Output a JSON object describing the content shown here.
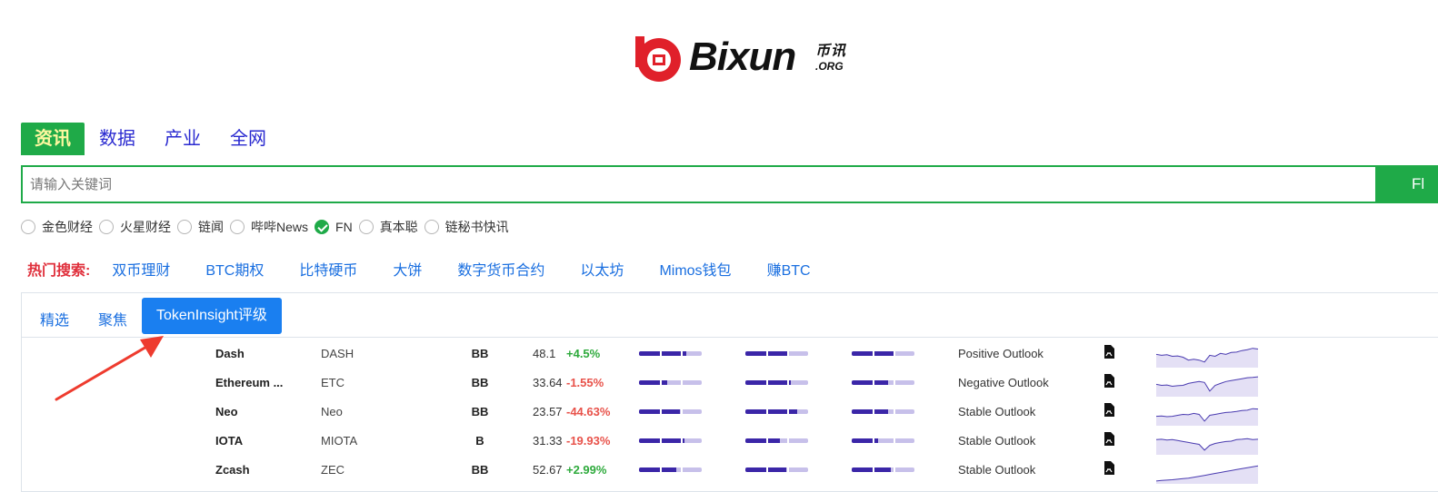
{
  "logo": {
    "name": "Bixun",
    "cn": "币讯",
    "org": ".ORG",
    "colors": {
      "red": "#e0202a",
      "black": "#111111"
    }
  },
  "category_tabs": [
    {
      "label": "资讯",
      "active": true
    },
    {
      "label": "数据",
      "active": false
    },
    {
      "label": "产业",
      "active": false
    },
    {
      "label": "全网",
      "active": false
    }
  ],
  "search": {
    "placeholder": "请输入关键词",
    "value": "",
    "button_label": "Fl"
  },
  "sources": [
    {
      "label": "金色财经",
      "checked": false
    },
    {
      "label": "火星财经",
      "checked": false
    },
    {
      "label": "链闻",
      "checked": false
    },
    {
      "label": "哔哔News",
      "checked": false
    },
    {
      "label": "FN",
      "checked": true
    },
    {
      "label": "真本聪",
      "checked": false
    },
    {
      "label": "链秘书快讯",
      "checked": false
    }
  ],
  "hot_search": {
    "label": "热门搜索:",
    "links": [
      "双币理财",
      "BTC期权",
      "比特硬币",
      "大饼",
      "数字货币合约",
      "以太坊",
      "Mimos钱包",
      "赚BTC"
    ]
  },
  "panel_tabs": [
    {
      "label": "精选",
      "active": false
    },
    {
      "label": "聚焦",
      "active": false
    },
    {
      "label": "TokenInsight评级",
      "active": true
    }
  ],
  "ratings": [
    {
      "name": "Dash",
      "symbol": "DASH",
      "grade": "BB",
      "score": "48.1",
      "change": "+4.5%",
      "direction": "up",
      "bars": [
        0.75,
        0.7,
        0.68
      ],
      "outlook": "Positive Outlook",
      "spark": [
        0.6,
        0.55,
        0.58,
        0.5,
        0.52,
        0.45,
        0.3,
        0.35,
        0.3,
        0.2,
        0.55,
        0.5,
        0.65,
        0.6,
        0.7,
        0.72,
        0.8,
        0.85,
        0.92,
        0.88
      ]
    },
    {
      "name": "Ethereum ...",
      "symbol": "ETC",
      "grade": "BB",
      "score": "33.64",
      "change": "-1.55%",
      "direction": "down",
      "bars": [
        0.45,
        0.72,
        0.58
      ],
      "outlook": "Negative Outlook",
      "spark": [
        0.55,
        0.5,
        0.52,
        0.45,
        0.48,
        0.5,
        0.6,
        0.65,
        0.7,
        0.65,
        0.2,
        0.5,
        0.6,
        0.7,
        0.75,
        0.8,
        0.85,
        0.9,
        0.92,
        0.95
      ]
    },
    {
      "name": "Neo",
      "symbol": "Neo",
      "grade": "BB",
      "score": "23.57",
      "change": "-44.63%",
      "direction": "down",
      "bars": [
        0.65,
        0.82,
        0.58
      ],
      "outlook": "Stable Outlook",
      "spark": [
        0.4,
        0.42,
        0.38,
        0.4,
        0.45,
        0.5,
        0.48,
        0.55,
        0.5,
        0.15,
        0.45,
        0.5,
        0.55,
        0.6,
        0.62,
        0.65,
        0.7,
        0.72,
        0.8,
        0.78
      ]
    },
    {
      "name": "IOTA",
      "symbol": "MIOTA",
      "grade": "B",
      "score": "31.33",
      "change": "-19.93%",
      "direction": "down",
      "bars": [
        0.72,
        0.55,
        0.42
      ],
      "outlook": "Stable Outlook",
      "spark": [
        0.7,
        0.72,
        0.68,
        0.7,
        0.65,
        0.6,
        0.55,
        0.5,
        0.45,
        0.15,
        0.4,
        0.5,
        0.55,
        0.6,
        0.62,
        0.7,
        0.72,
        0.75,
        0.7,
        0.72
      ]
    },
    {
      "name": "Zcash",
      "symbol": "ZEC",
      "grade": "BB",
      "score": "52.67",
      "change": "+2.99%",
      "direction": "up",
      "bars": [
        0.6,
        0.65,
        0.62
      ],
      "outlook": "Stable Outlook",
      "spark": [
        0.05,
        0.08,
        0.1,
        0.12,
        0.15,
        0.18,
        0.2,
        0.25,
        0.3,
        0.35,
        0.4,
        0.45,
        0.5,
        0.55,
        0.6,
        0.65,
        0.7,
        0.75,
        0.8,
        0.85
      ]
    }
  ],
  "colors": {
    "green": "#1faa48",
    "blue": "#1a6fe0",
    "tab_active": "#1a7ff0",
    "hot_red": "#e0303c",
    "up": "#2eaa3c",
    "down": "#e8524a",
    "bar_fill": "#3b26a8",
    "bar_bg": "#c7c0ea",
    "arrow": "#ee3b2e"
  },
  "icons": {
    "pdf": "pdf-icon",
    "check": "check-icon"
  }
}
